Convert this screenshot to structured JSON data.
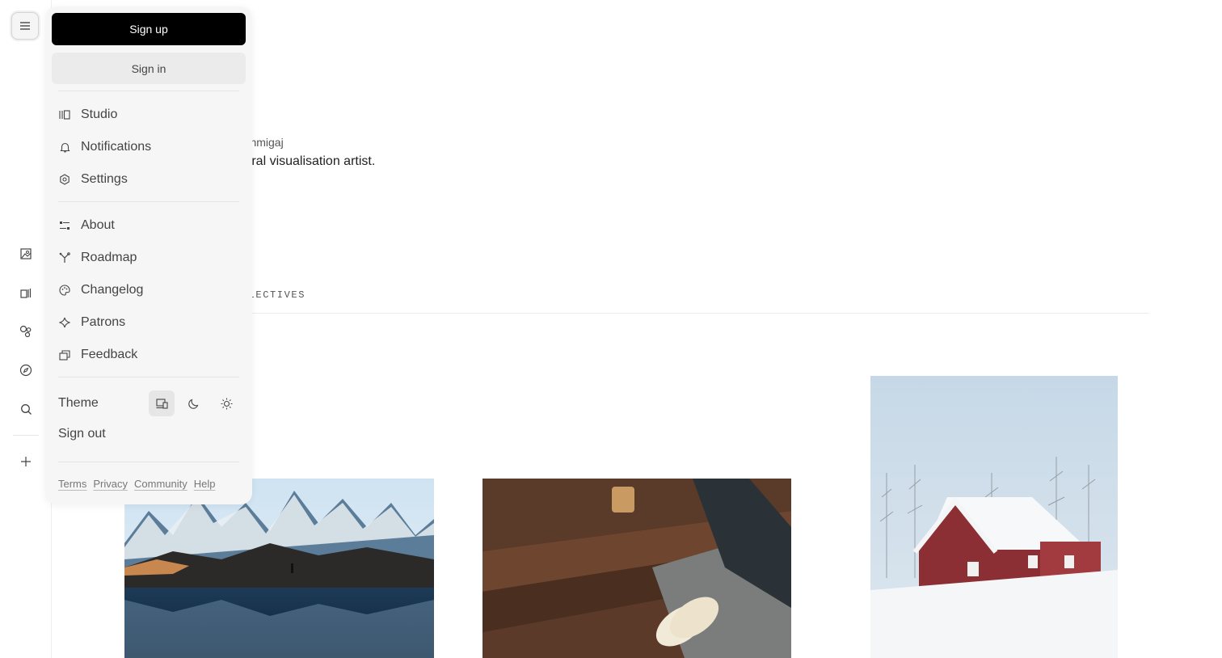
{
  "profile": {
    "handle": "monmigaj",
    "bio": "ctural visualisation artist.",
    "tab": "OLLECTIVES"
  },
  "menu": {
    "signup_label": "Sign up",
    "signin_label": "Sign in",
    "group1": [
      {
        "label": "Studio",
        "icon": "studio-icon"
      },
      {
        "label": "Notifications",
        "icon": "bell-icon"
      },
      {
        "label": "Settings",
        "icon": "settings-icon"
      }
    ],
    "group2": [
      {
        "label": "About",
        "icon": "about-icon"
      },
      {
        "label": "Roadmap",
        "icon": "roadmap-icon"
      },
      {
        "label": "Changelog",
        "icon": "palette-icon"
      },
      {
        "label": "Patrons",
        "icon": "sparkle-icon"
      },
      {
        "label": "Feedback",
        "icon": "feedback-icon"
      }
    ],
    "theme_label": "Theme",
    "theme_options": [
      "system",
      "dark",
      "light"
    ],
    "theme_selected": "system",
    "signout_label": "Sign out",
    "footer_links": [
      "Terms",
      "Privacy",
      "Community",
      "Help"
    ]
  },
  "rail": {
    "icons": [
      "menu-icon",
      "image-icon",
      "library-icon",
      "shapes-icon",
      "compass-icon",
      "search-icon",
      "plus-icon"
    ]
  },
  "colors": {
    "accent": "#000000",
    "panel_bg": "#f6f6f6",
    "text_muted": "#444444"
  }
}
